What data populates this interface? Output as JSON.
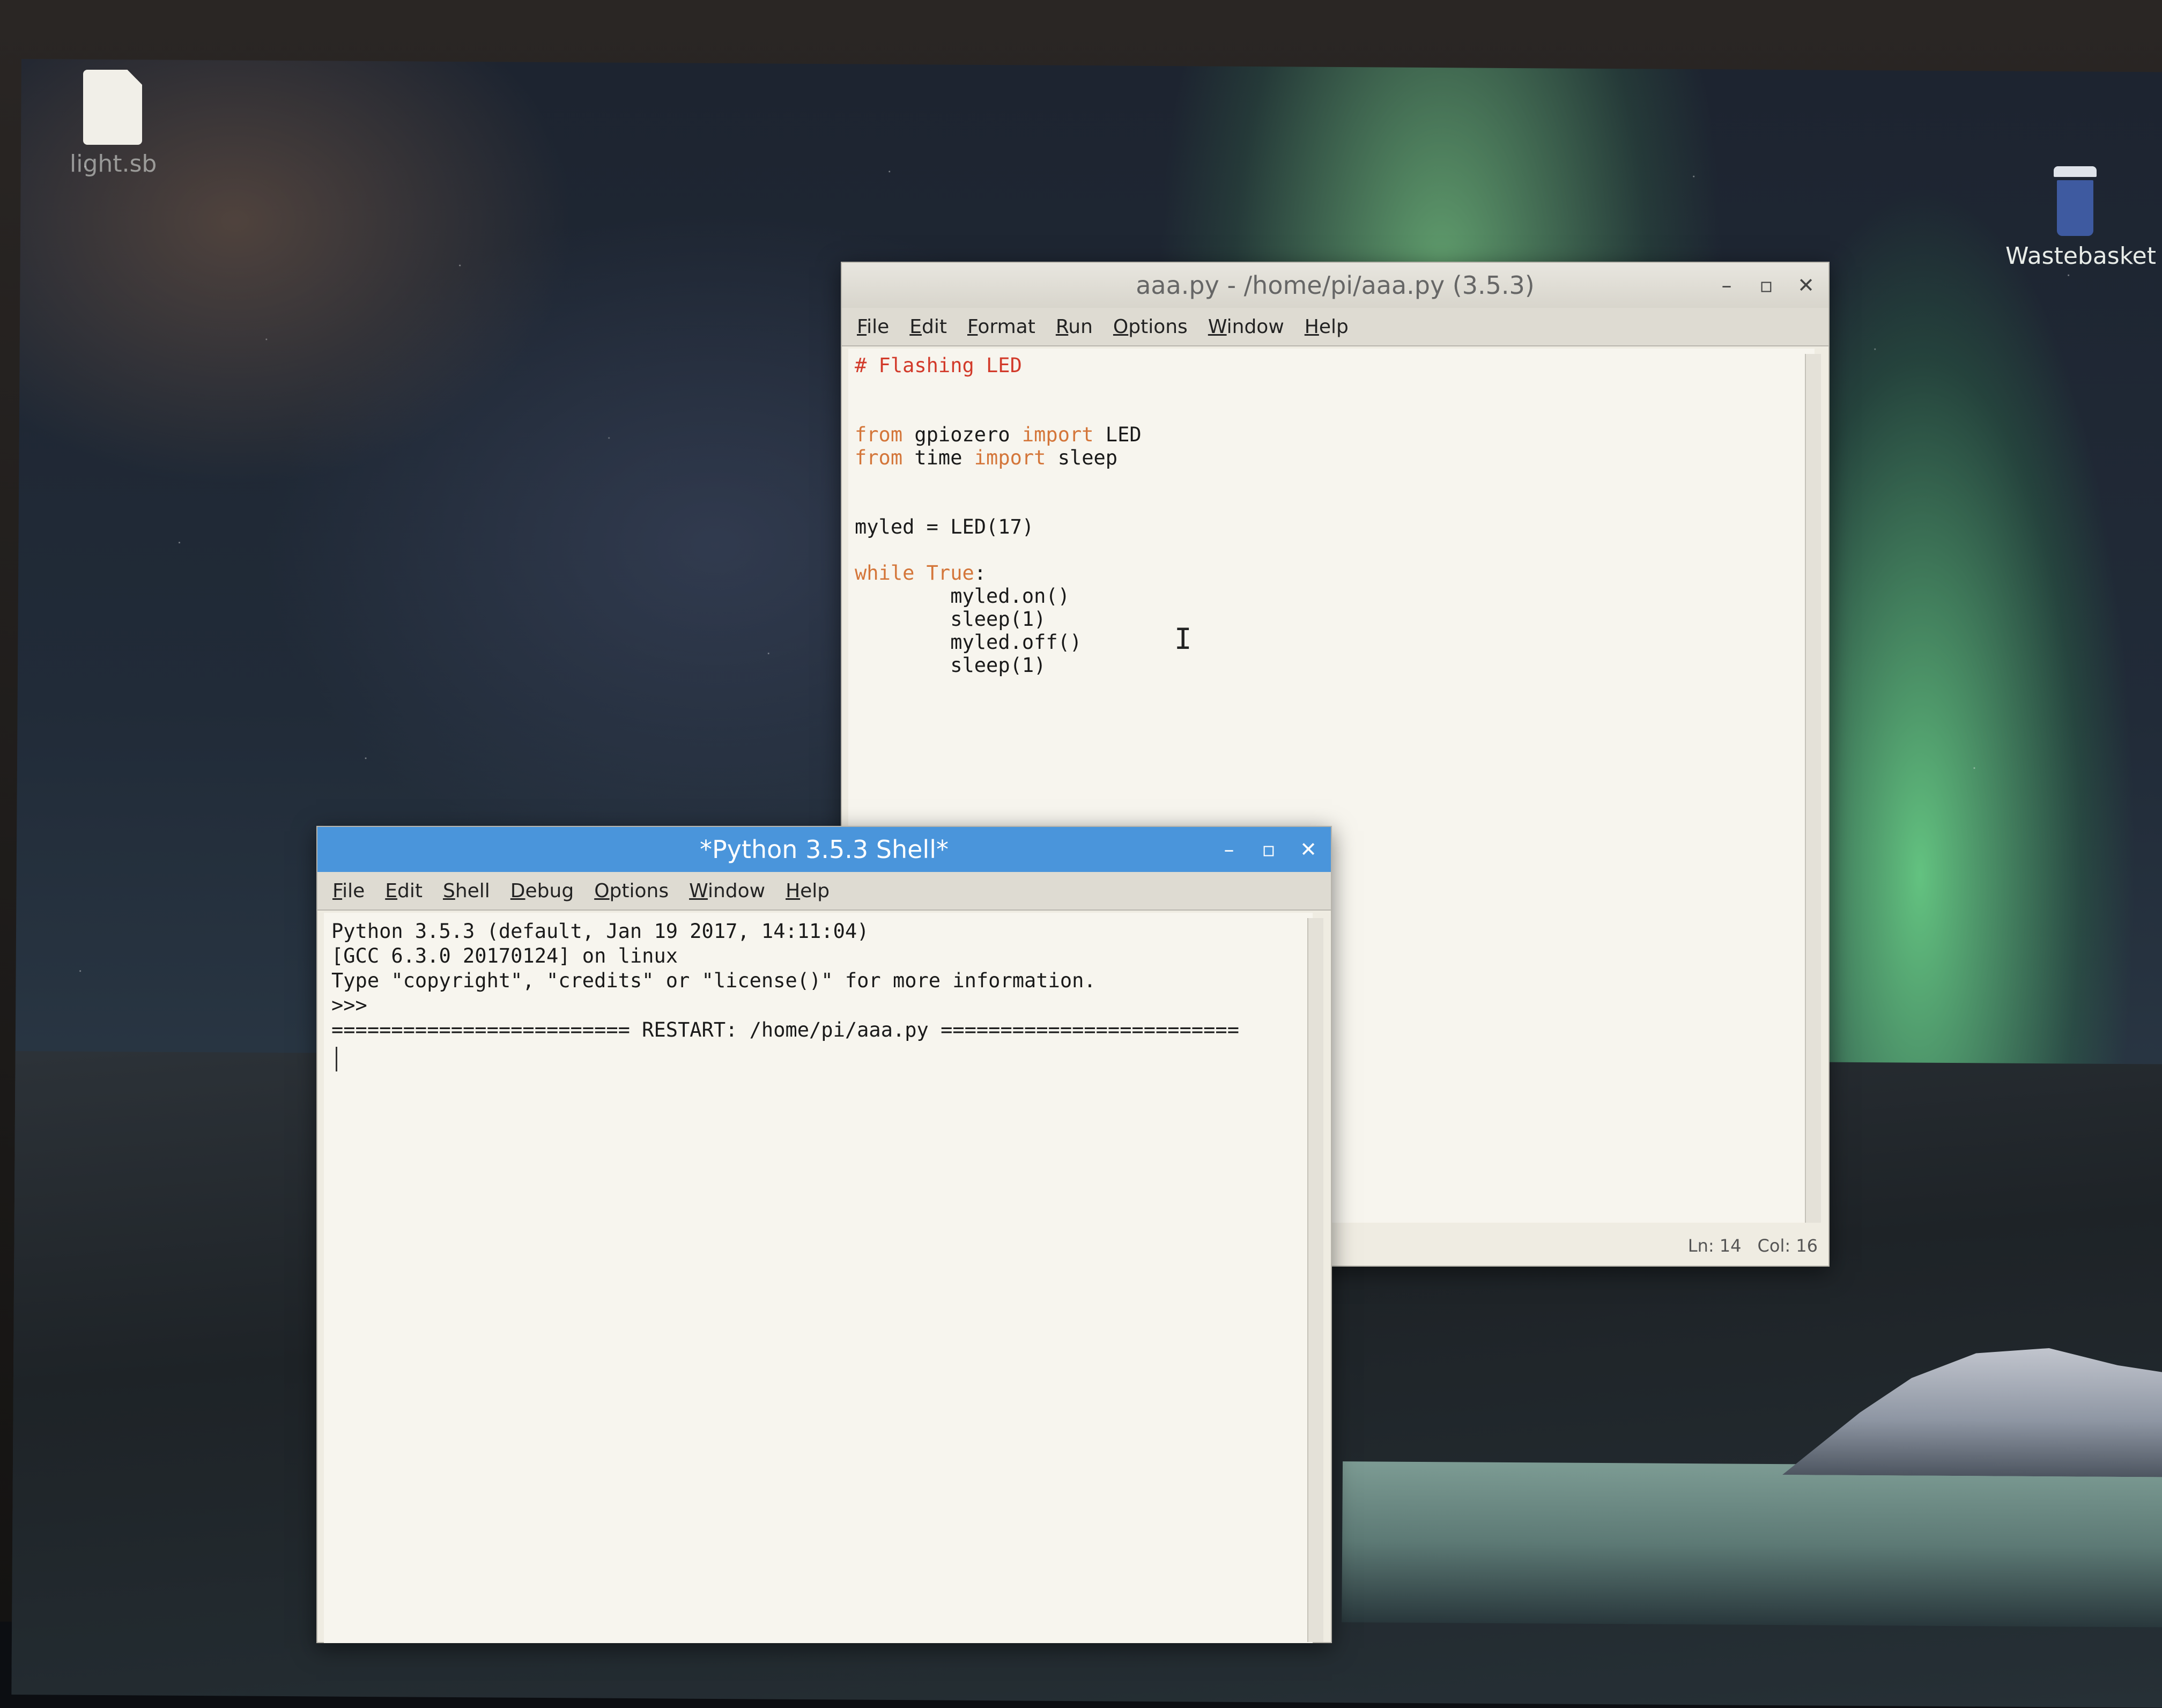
{
  "desktop": {
    "icons": [
      {
        "label": "light.sb",
        "icon": "file-icon"
      },
      {
        "label": "Wastebasket",
        "icon": "trash-icon"
      }
    ]
  },
  "editor": {
    "title": "aaa.py - /home/pi/aaa.py (3.5.3)",
    "menu": [
      "File",
      "Edit",
      "Format",
      "Run",
      "Options",
      "Window",
      "Help"
    ],
    "code": {
      "comment": "# Flashing LED",
      "from_kw": "from",
      "import_kw": "import",
      "mod1": " gpiozero ",
      "name1": " LED",
      "mod2": " time ",
      "name2": " sleep",
      "assign": "myled = LED(17)",
      "while_kw": "while True",
      "while_rest": ":",
      "body": [
        "myled.on()",
        "sleep(1)",
        "myled.off()",
        "sleep(1)"
      ]
    },
    "status": {
      "line": "Ln: 14",
      "col": "Col: 16"
    },
    "ibeam": "I"
  },
  "shell": {
    "title": "*Python 3.5.3 Shell*",
    "menu": [
      "File",
      "Edit",
      "Shell",
      "Debug",
      "Options",
      "Window",
      "Help"
    ],
    "lines": [
      "Python 3.5.3 (default, Jan 19 2017, 14:11:04)",
      "[GCC 6.3.0 20170124] on linux",
      "Type \"copyright\", \"credits\" or \"license()\" for more information.",
      ">>>",
      "========================= RESTART: /home/pi/aaa.py ========================="
    ]
  },
  "controls": {
    "minimize": "–",
    "maximize": "▫",
    "close": "✕"
  },
  "colors": {
    "shell_titlebar": "#4a95db",
    "keyword": "#d4763a",
    "comment": "#d23a2a"
  }
}
